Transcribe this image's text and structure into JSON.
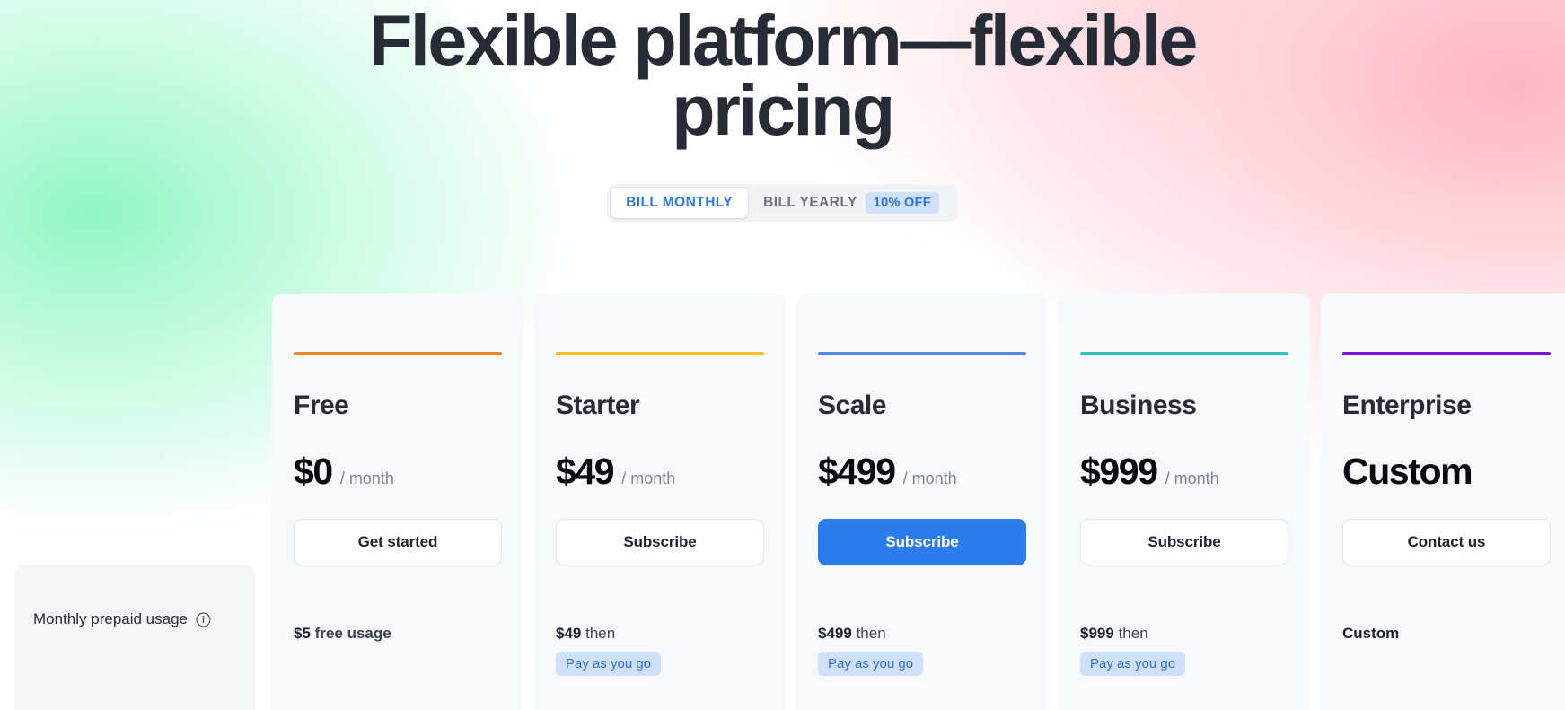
{
  "hero": {
    "title": "Flexible platform—flexible pricing"
  },
  "billing_toggle": {
    "monthly_label": "BILL MONTHLY",
    "yearly_label": "BILL YEARLY",
    "discount_badge": "10% OFF",
    "active": "BILL MONTHLY"
  },
  "left_panel": {
    "label": "Monthly prepaid usage",
    "info_icon": "info-icon"
  },
  "plans": [
    {
      "name": "Free",
      "accent_color": "#ef8327",
      "price_amount": "$0",
      "price_period": "/ month",
      "cta_label": "Get started",
      "cta_style": "outline",
      "usage_amount": "$5",
      "usage_suffix": "free usage",
      "payg_badge": ""
    },
    {
      "name": "Starter",
      "accent_color": "#f2c026",
      "price_amount": "$49",
      "price_period": "/ month",
      "cta_label": "Subscribe",
      "cta_style": "outline",
      "usage_amount": "$49",
      "usage_suffix": "then",
      "payg_badge": "Pay as you go"
    },
    {
      "name": "Scale",
      "accent_color": "#5585dd",
      "price_amount": "$499",
      "price_period": "/ month",
      "cta_label": "Subscribe",
      "cta_style": "primary",
      "usage_amount": "$499",
      "usage_suffix": "then",
      "payg_badge": "Pay as you go"
    },
    {
      "name": "Business",
      "accent_color": "#2cc4bb",
      "price_amount": "$999",
      "price_period": "/ month",
      "cta_label": "Subscribe",
      "cta_style": "outline",
      "usage_amount": "$999",
      "usage_suffix": "then",
      "payg_badge": "Pay as you go"
    },
    {
      "name": "Enterprise",
      "accent_color": "#7a16e0",
      "price_amount": "Custom",
      "price_period": "",
      "cta_label": "Contact us",
      "cta_style": "outline",
      "usage_amount": "Custom",
      "usage_suffix": "",
      "payg_badge": ""
    }
  ],
  "colors": {
    "primary_blue": "#2b7cea",
    "badge_bg": "#cfe0fb",
    "badge_text": "#2f6fe0",
    "card_bg": "#f7f9fc",
    "heading": "#262b35"
  }
}
